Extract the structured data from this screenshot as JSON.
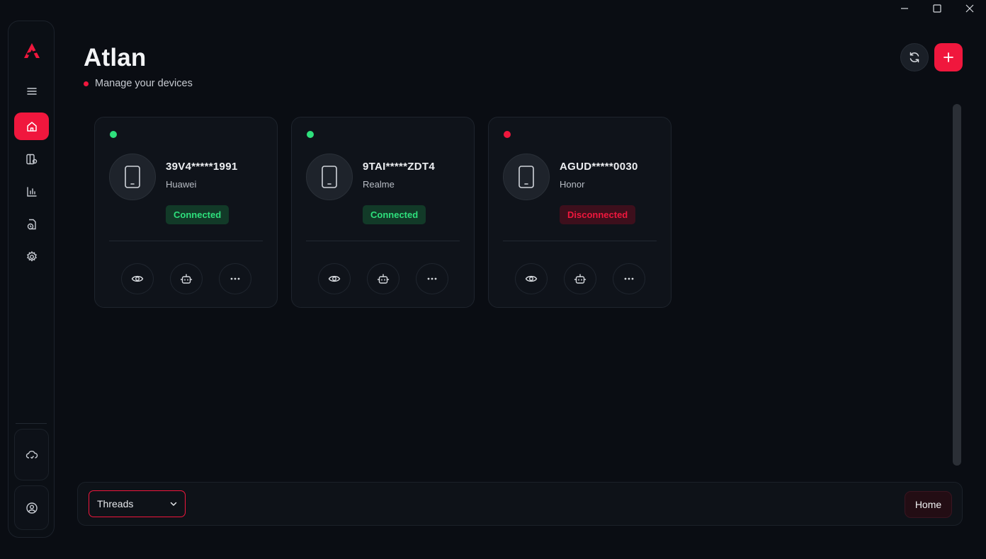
{
  "app": {
    "title": "Atlan",
    "subtitle": "Manage your devices",
    "accent_color": "#f0173d"
  },
  "window_controls": [
    "minimize-icon",
    "maximize-icon",
    "close-icon"
  ],
  "sidebar": {
    "logo": "atlan-logo",
    "items": [
      {
        "icon": "menu-icon",
        "active": false
      },
      {
        "icon": "home-icon",
        "active": true
      },
      {
        "icon": "devices-settings-icon",
        "active": false
      },
      {
        "icon": "bar-chart-icon",
        "active": false
      },
      {
        "icon": "file-clock-icon",
        "active": false
      },
      {
        "icon": "gear-icon",
        "active": false
      }
    ],
    "bottom": [
      {
        "icon": "cloud-sync-icon"
      },
      {
        "icon": "user-circle-icon"
      }
    ]
  },
  "header_actions": [
    {
      "icon": "refresh-icon"
    },
    {
      "icon": "plus-icon"
    }
  ],
  "devices": [
    {
      "name": "39V4*****1991",
      "brand": "Huawei",
      "status": "Connected",
      "online": true
    },
    {
      "name": "9TAI*****ZDT4",
      "brand": "Realme",
      "status": "Connected",
      "online": true
    },
    {
      "name": "AGUD*****0030",
      "brand": "Honor",
      "status": "Disconnected",
      "online": false
    }
  ],
  "device_actions": [
    "eye-icon",
    "robot-icon",
    "more-dots-icon"
  ],
  "bottom_bar": {
    "select_value": "Threads",
    "home_label": "Home"
  }
}
